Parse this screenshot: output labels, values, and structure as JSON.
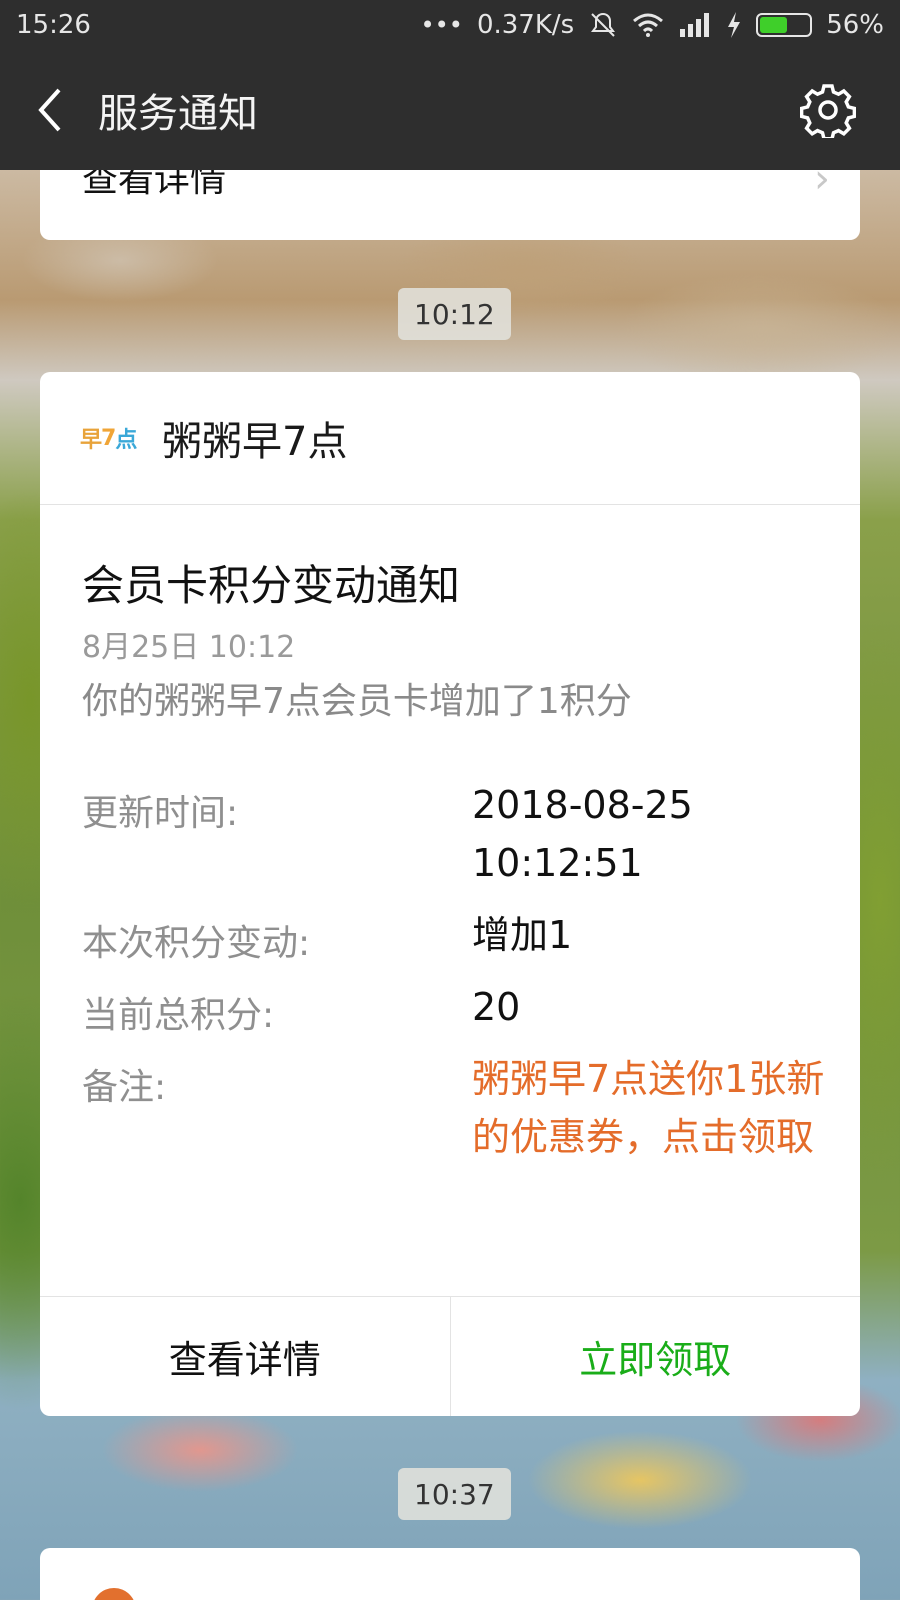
{
  "status": {
    "time": "15:26",
    "dots": "•••",
    "speed": "0.37K/s",
    "battery": "56%",
    "battery_level": 0.56
  },
  "header": {
    "title": "服务通知"
  },
  "top_card": {
    "text": "查看详情"
  },
  "time_pill_1": "10:12",
  "notice": {
    "brand": "粥粥早7点",
    "title": "会员卡积分变动通知",
    "date": "8月25日  10:12",
    "summary": "你的粥粥早7点会员卡增加了1积分",
    "fields": [
      {
        "label": "更新时间:",
        "value": "2018-08-25 10:12:51"
      },
      {
        "label": "本次积分变动:",
        "value": "增加1"
      },
      {
        "label": "当前总积分:",
        "value": "20"
      },
      {
        "label": "备注:",
        "value": "粥粥早7点送你1张新的优惠券，点击领取"
      }
    ],
    "actions": {
      "view_details": "查看详情",
      "claim_now": "立即领取"
    }
  },
  "time_pill_2": "10:37",
  "colors": {
    "bar": "#2e2e2e",
    "accent_green": "#1aad19",
    "remark_orange": "#e46c2a"
  }
}
